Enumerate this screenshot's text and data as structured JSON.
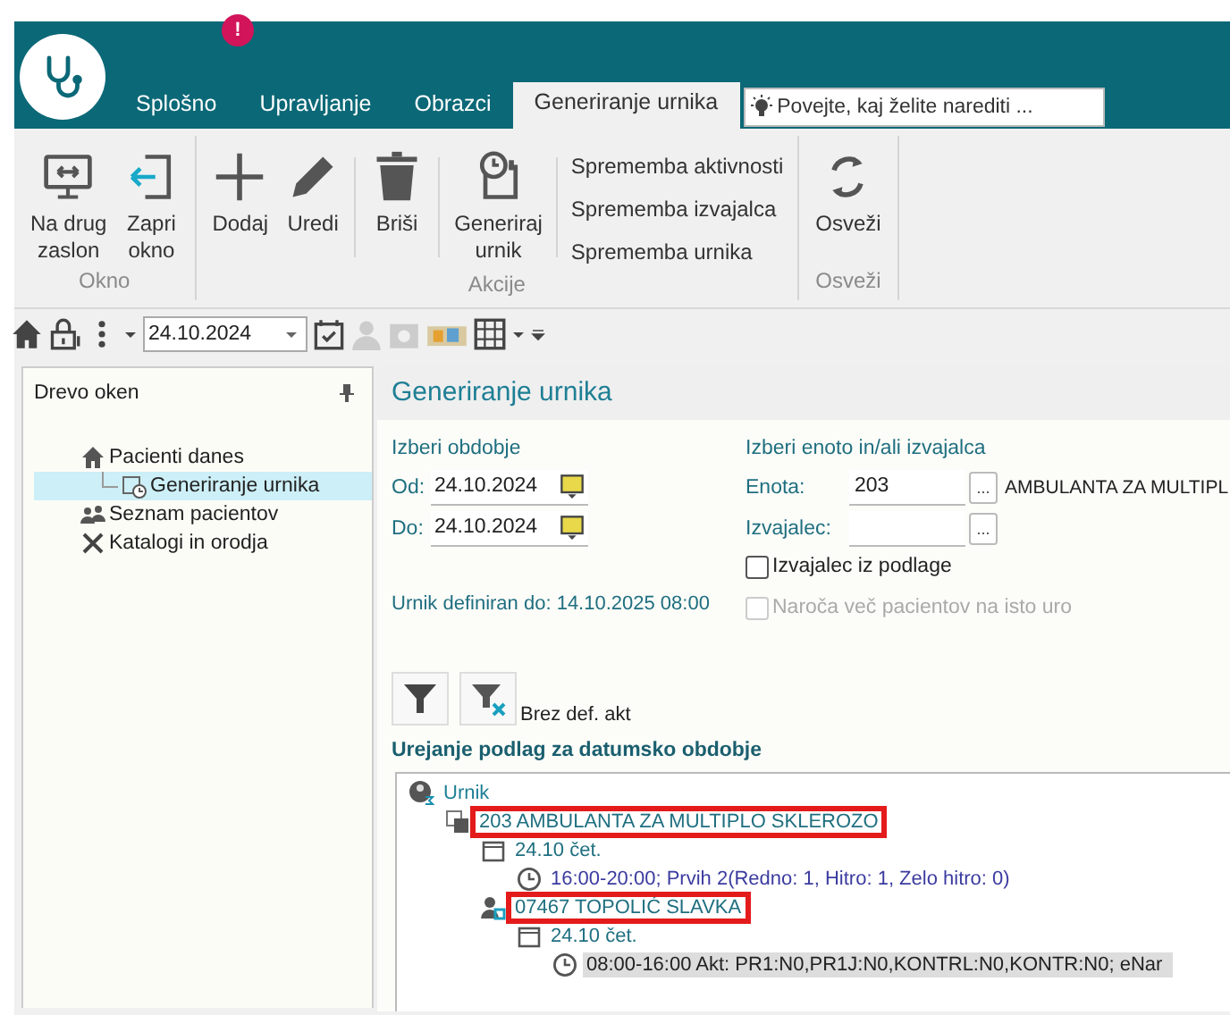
{
  "app_header": {
    "notification_badge": "!",
    "tabs": [
      {
        "label": "Splošno",
        "selected": false
      },
      {
        "label": "Upravljanje",
        "selected": false
      },
      {
        "label": "Obrazci",
        "selected": false
      },
      {
        "label": "Generiranje urnika",
        "selected": true
      }
    ],
    "search": {
      "placeholder": "Povejte, kaj želite narediti ..."
    }
  },
  "ribbon": {
    "groups": [
      {
        "label": "Okno",
        "buttons": [
          {
            "label": "Na drug\nzaslon",
            "kind": "screen"
          },
          {
            "label": "Zapri\nokno",
            "kind": "close-window"
          }
        ]
      },
      {
        "label": "Akcije",
        "buttons": [
          {
            "label": "Dodaj",
            "kind": "add"
          },
          {
            "label": "Uredi",
            "kind": "edit"
          },
          {
            "label": "Briši",
            "kind": "delete"
          },
          {
            "label": "Generiraj\nurnik",
            "kind": "generate"
          }
        ],
        "links": [
          "Sprememba aktivnosti",
          "Sprememba izvajalca",
          "Sprememba urnika"
        ]
      },
      {
        "label": "Osveži",
        "buttons": [
          {
            "label": "Osveži",
            "kind": "refresh"
          }
        ]
      }
    ]
  },
  "quick_toolbar": {
    "date": "24.10.2024"
  },
  "sidebar": {
    "title": "Drevo oken",
    "items": [
      {
        "label": "Pacienti danes",
        "kind": "home",
        "selected": false,
        "children": [
          {
            "label": "Generiranje urnika",
            "kind": "schedule",
            "selected": true
          }
        ]
      },
      {
        "label": "Seznam pacientov",
        "kind": "people",
        "selected": false
      },
      {
        "label": "Katalogi in orodja",
        "kind": "tools",
        "selected": false
      }
    ]
  },
  "main": {
    "title": "Generiranje urnika",
    "period": {
      "heading": "Izberi obdobje",
      "from_label": "Od:",
      "from": "24.10.2024",
      "to_label": "Do:",
      "to": "24.10.2024"
    },
    "unit": {
      "heading": "Izberi enoto in/ali izvajalca",
      "unit_label": "Enota:",
      "unit_value": "203",
      "unit_button": "...",
      "unit_name": "AMBULANTA ZA MULTIPL",
      "provider_label": "Izvajalec:",
      "provider_button": "...",
      "checkboxes": [
        {
          "label": "Izvajalec iz podlage",
          "checked": false,
          "disabled": false
        },
        {
          "label": "Naroča več pacientov na isto uro",
          "checked": false,
          "disabled": true
        }
      ]
    },
    "defined_until": "Urnik definiran do: 14.10.2025 08:00",
    "filter_label": "Brez def. akt",
    "tree_heading": "Urejanje podlag za datumsko obdobje",
    "tree": [
      {
        "label": "Urnik",
        "kind": "root",
        "highlighted": false,
        "selected": false,
        "children": [
          {
            "label": "203 AMBULANTA ZA MULTIPLO SKLEROZO",
            "kind": "unit",
            "highlighted": true,
            "selected": false,
            "children": [
              {
                "label": "24.10 čet.",
                "kind": "day",
                "highlighted": false,
                "selected": false,
                "children": [
                  {
                    "label": "16:00-20:00; Prvih 2(Redno: 1, Hitro: 1, Zelo hitro: 0)",
                    "kind": "slot",
                    "highlighted": false,
                    "selected": false
                  }
                ]
              },
              {
                "label": "07467 TOPOLIĆ SLAVKA",
                "kind": "person",
                "highlighted": true,
                "selected": false,
                "children": [
                  {
                    "label": "24.10 čet.",
                    "kind": "day",
                    "highlighted": false,
                    "selected": false,
                    "children": [
                      {
                        "label": "08:00-16:00  Akt: PR1:N0,PR1J:N0,KONTRL:N0,KONTR:N0; eNar",
                        "kind": "activity",
                        "highlighted": false,
                        "selected": true
                      }
                    ]
                  }
                ]
              }
            ]
          }
        ]
      }
    ]
  }
}
